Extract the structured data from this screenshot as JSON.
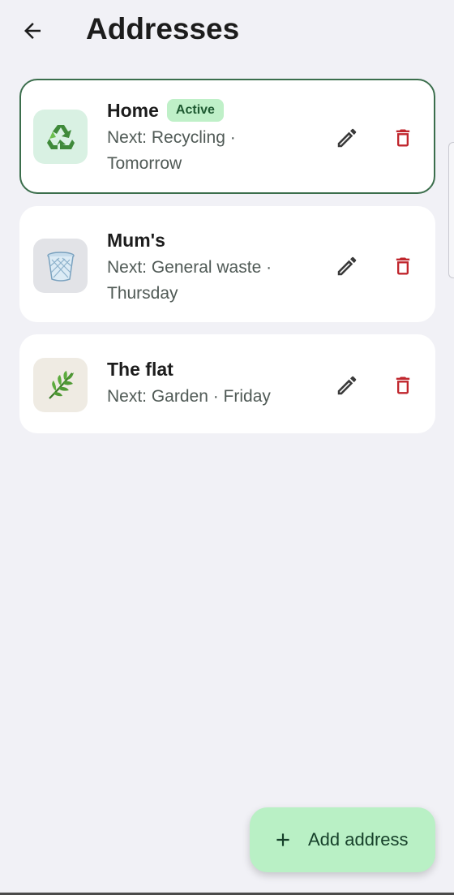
{
  "app_bar": {
    "title": "Addresses",
    "back_icon": "arrow-left-icon"
  },
  "addresses": [
    {
      "name": "Home",
      "badge": "Active",
      "next_line_1": "Next: Recycling ·",
      "next_line_2": "Tomorrow",
      "icon": "recycling-icon",
      "tile_color": "#d9f1e3",
      "active": true
    },
    {
      "name": "Mum's",
      "badge": "",
      "next_line_1": "Next: General waste ·",
      "next_line_2": "Thursday",
      "icon": "general-waste-bin-icon",
      "tile_color": "#e2e3e7",
      "active": false
    },
    {
      "name": "The flat",
      "badge": "",
      "next_line_1": "Next: Garden · Friday",
      "next_line_2": "",
      "icon": "garden-leaf-icon",
      "tile_color": "#efebe3",
      "active": false
    }
  ],
  "actions": {
    "edit_icon": "pencil-icon",
    "delete_icon": "trash-icon",
    "delete_color": "#c0262d"
  },
  "fab": {
    "label": "Add address",
    "icon": "plus-icon",
    "color": "#b9f0c5"
  },
  "colors": {
    "background": "#f1f1f6",
    "active_border": "#3b6e4c"
  }
}
